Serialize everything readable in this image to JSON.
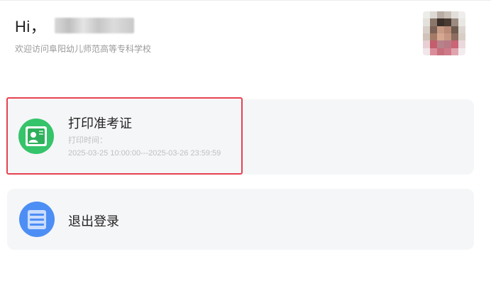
{
  "header": {
    "greeting": "Hi，",
    "subtitle": "欢迎访问阜阳幼儿师范高等专科学校"
  },
  "cards": [
    {
      "title": "打印准考证",
      "icon": "admission-ticket-icon",
      "print_time_label": "打印时间：",
      "print_time_range": "2025-03-25 10:00:00---2025-03-26 23:59:59",
      "highlighted": true
    },
    {
      "title": "退出登录",
      "icon": "document-list-icon"
    }
  ],
  "colors": {
    "highlight_border": "#e64152",
    "print_icon_bg": "#35c46a",
    "logout_icon_bg": "#4d8ef5",
    "card_bg": "#f5f6f8"
  }
}
